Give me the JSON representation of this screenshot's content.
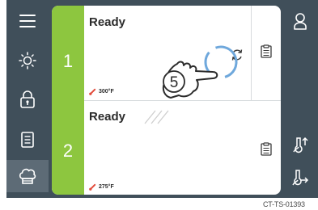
{
  "slots": [
    {
      "number": "1",
      "status": "Ready",
      "temperature": "300°F"
    },
    {
      "number": "2",
      "status": "Ready",
      "temperature": "275°F"
    }
  ],
  "callout": {
    "step": "5"
  },
  "caption": "CT-TS-01393",
  "colors": {
    "frame": "#404f5a",
    "active_nav": "#5d6b76",
    "slot_strip": "#8dc63f",
    "refresh_highlight": "#6fa8dc"
  },
  "icons": {
    "left_nav": [
      "menu-icon",
      "light-icon",
      "lock-icon",
      "recipe-book-icon",
      "chef-hat-icon"
    ],
    "right_nav": [
      "user-icon",
      "probe-up-icon",
      "probe-right-icon"
    ]
  }
}
